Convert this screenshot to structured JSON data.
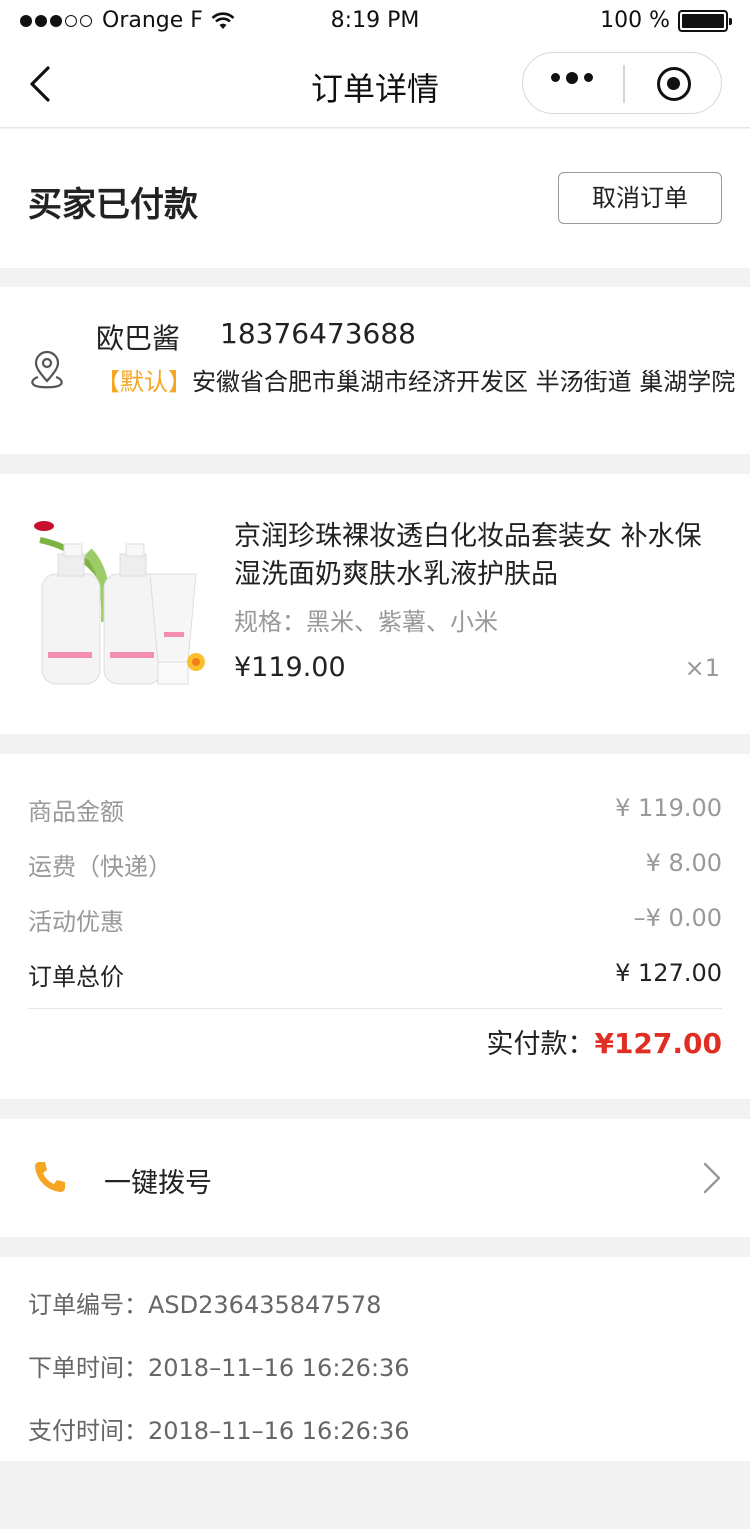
{
  "status_bar": {
    "carrier": "Orange F",
    "time": "8:19 PM",
    "battery": "100 %"
  },
  "nav": {
    "title": "订单详情"
  },
  "order_status": {
    "title": "买家已付款",
    "cancel_label": "取消订单"
  },
  "address": {
    "name": "欧巴酱",
    "phone": "18376473688",
    "default_tag": "【默认】",
    "detail": "安徽省合肥市巢湖市经济开发区 半汤街道 巢湖学院"
  },
  "product": {
    "name": "京润珍珠裸妆透白化妆品套装女 补水保湿洗面奶爽肤水乳液护肤品",
    "spec": "规格：黑米、紫薯、小米",
    "price": "¥119.00",
    "qty": "×1"
  },
  "summary": {
    "rows": [
      {
        "label": "商品金额",
        "value": "¥ 119.00"
      },
      {
        "label": "运费（快递）",
        "value": "¥ 8.00"
      },
      {
        "label": "活动优惠",
        "value": "–¥ 0.00"
      },
      {
        "label": "订单总价",
        "value": "¥ 127.00"
      }
    ],
    "paid_label": "实付款：",
    "paid_amount": "¥127.00"
  },
  "call": {
    "label": "一键拨号"
  },
  "order_info": {
    "rows": [
      {
        "label": "订单编号：",
        "value": "ASD236435847578"
      },
      {
        "label": "下单时间：",
        "value": "2018–11–16  16:26:36"
      },
      {
        "label": "支付时间：",
        "value": "2018–11–16  16:26:36"
      }
    ]
  },
  "colors": {
    "accent_orange": "#f5a623",
    "price_red": "#e02e24",
    "background": "#f2f2f2"
  }
}
